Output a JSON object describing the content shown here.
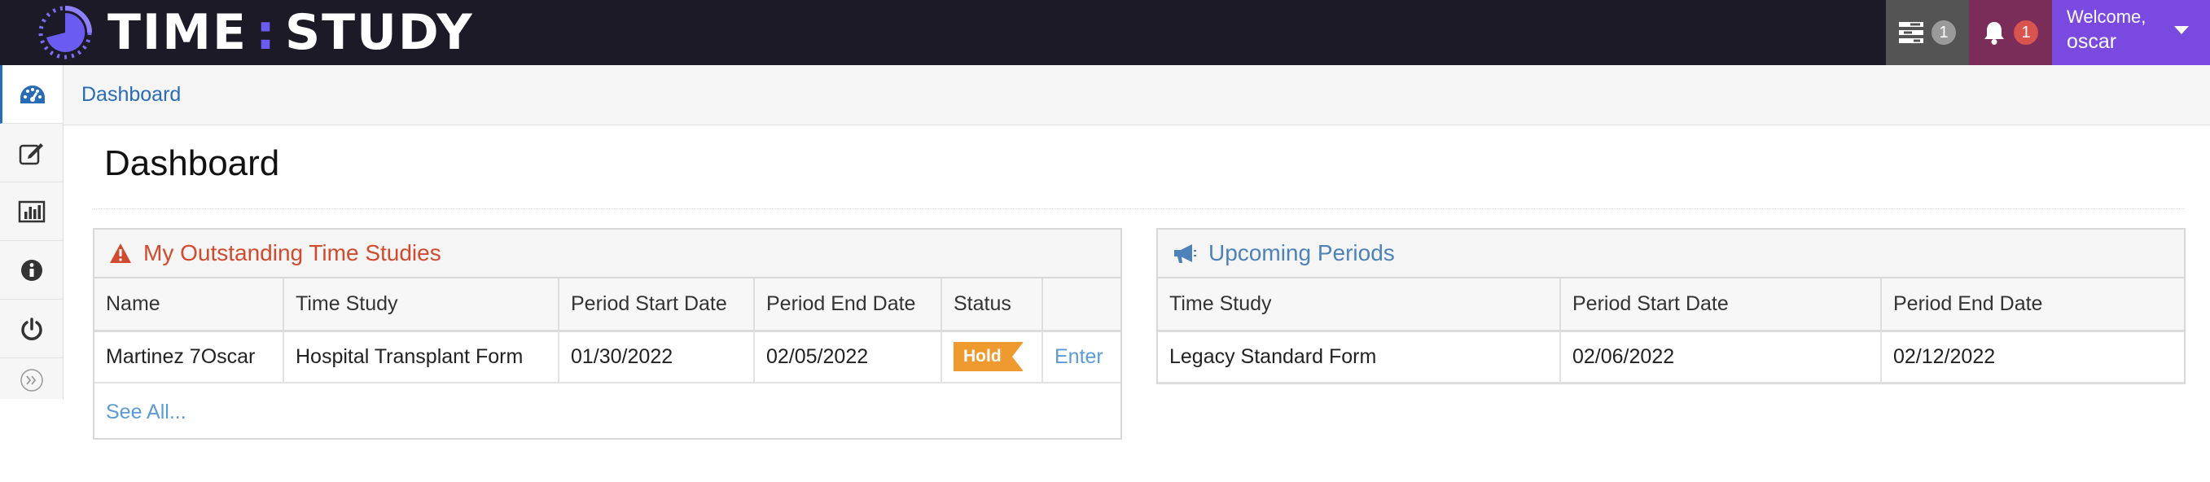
{
  "app": {
    "logo_left": "TIME",
    "logo_sep": ":",
    "logo_right": "STUDY"
  },
  "header": {
    "tasks_count": "1",
    "notifications_count": "1",
    "welcome_label": "Welcome,",
    "username": "oscar"
  },
  "breadcrumb": {
    "current": "Dashboard"
  },
  "page": {
    "title": "Dashboard"
  },
  "outstanding": {
    "title": "My Outstanding Time Studies",
    "columns": [
      "Name",
      "Time Study",
      "Period Start Date",
      "Period End Date",
      "Status",
      ""
    ],
    "rows": [
      {
        "name": "Martinez 7Oscar",
        "time_study": "Hospital Transplant Form",
        "start": "01/30/2022",
        "end": "02/05/2022",
        "status": "Hold",
        "action": "Enter"
      }
    ],
    "see_all": "See All..."
  },
  "upcoming": {
    "title": "Upcoming Periods",
    "columns": [
      "Time Study",
      "Period Start Date",
      "Period End Date"
    ],
    "rows": [
      {
        "time_study": "Legacy Standard Form",
        "start": "02/06/2022",
        "end": "02/12/2022"
      }
    ]
  },
  "icons": {
    "sidebar": [
      "dashboard-icon",
      "edit-icon",
      "bar-chart-icon",
      "info-icon",
      "power-icon",
      "expand-icon"
    ]
  },
  "colors": {
    "navbar": "#1b1a26",
    "accent_purple": "#7a4ae0",
    "bell_bg": "#7b2d5a",
    "tasks_bg": "#545454",
    "link_blue": "#2a6cb3",
    "warning_red": "#d14a2e",
    "hold_orange": "#ef9a2e"
  }
}
